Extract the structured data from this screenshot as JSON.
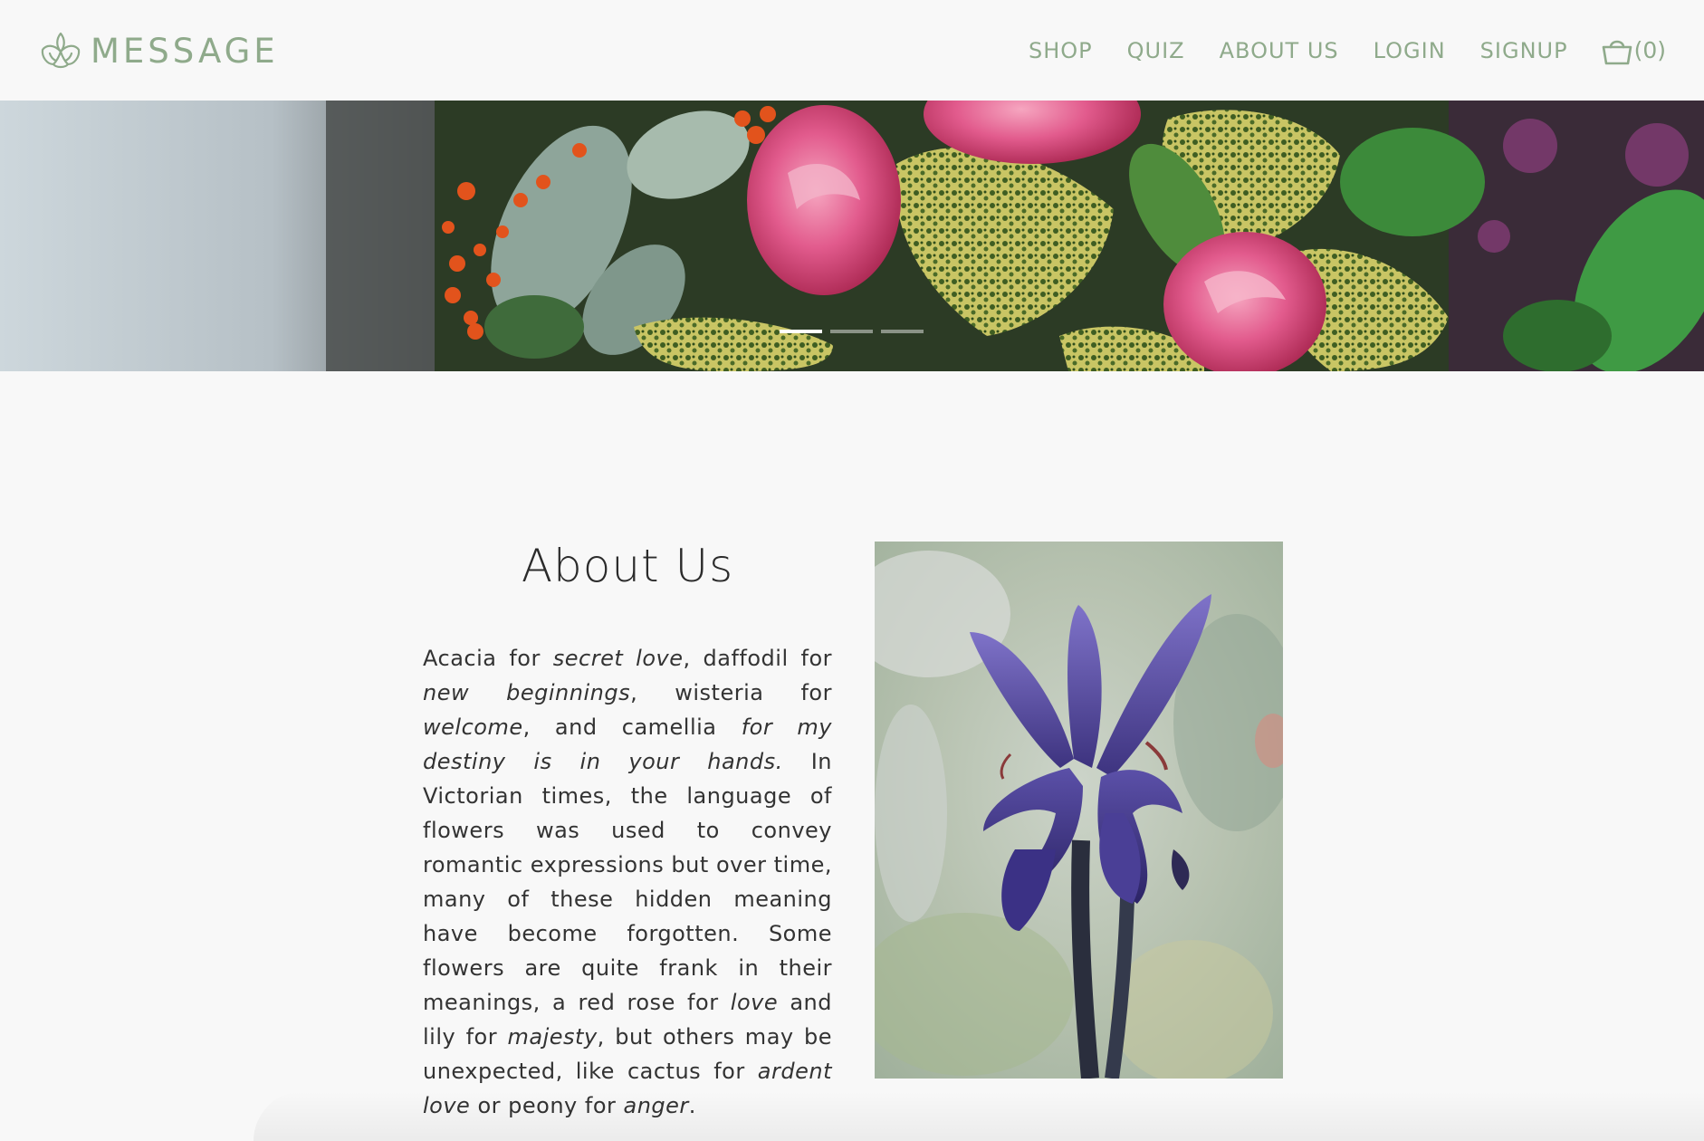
{
  "brand": {
    "name": "MESSAGE",
    "accent_color": "#8faa8b",
    "logo_icon": "iris-flower-icon"
  },
  "nav": {
    "links": [
      "SHOP",
      "QUIZ",
      "ABOUT US",
      "LOGIN",
      "SIGNUP"
    ],
    "cart_icon": "shopping-basket-icon",
    "cart_count": "(0)"
  },
  "carousel": {
    "slide_count": 3,
    "active_index": 0
  },
  "about": {
    "title": "About Us",
    "segments": [
      {
        "text": "Acacia for ",
        "italic": false
      },
      {
        "text": "secret love",
        "italic": true
      },
      {
        "text": ", daffodil for ",
        "italic": false
      },
      {
        "text": "new beginnings",
        "italic": true
      },
      {
        "text": ", wisteria for ",
        "italic": false
      },
      {
        "text": "welcome",
        "italic": true
      },
      {
        "text": ", and camellia ",
        "italic": false
      },
      {
        "text": "for my destiny is in your hands.",
        "italic": true
      },
      {
        "text": " In Victorian times, the language of flowers was used to convey romantic expressions but over time, many of these hidden meaning have become forgotten. Some flowers are quite frank in their meanings, a red rose for ",
        "italic": false
      },
      {
        "text": "love",
        "italic": true
      },
      {
        "text": " and lily for ",
        "italic": false
      },
      {
        "text": "majesty",
        "italic": true
      },
      {
        "text": ", but others may be unexpected, like cactus for ",
        "italic": false
      },
      {
        "text": "ardent love",
        "italic": true
      },
      {
        "text": " or peony for ",
        "italic": false
      },
      {
        "text": "anger",
        "italic": true
      },
      {
        "text": ".",
        "italic": false
      }
    ]
  }
}
